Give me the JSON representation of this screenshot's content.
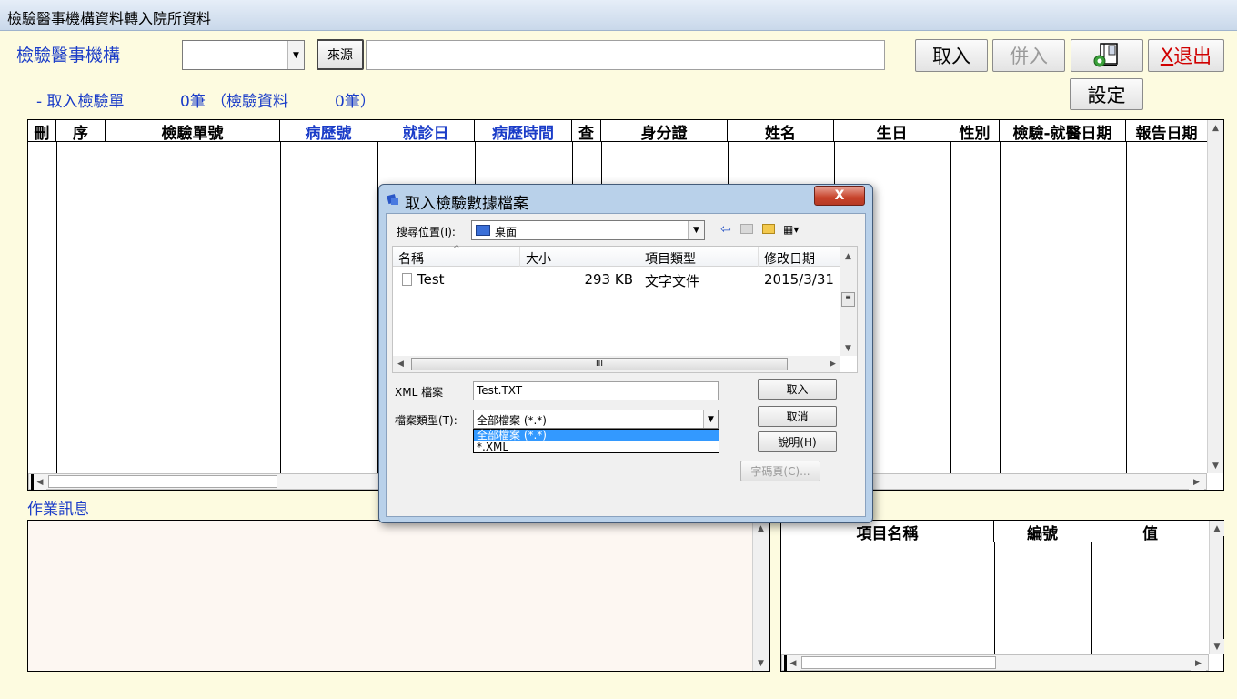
{
  "window": {
    "title": "檢驗醫事機構資料轉入院所資料"
  },
  "header": {
    "agency_label": "檢驗醫事機構",
    "agency_value": "",
    "source_button": "來源",
    "source_path": "",
    "import_button": "取入",
    "merge_button": "併入",
    "exit_button_key": "X",
    "exit_button_label": "退出",
    "settings_button": "設定",
    "summary_prefix": "-  取入檢驗單",
    "order_count": "0筆",
    "data_count_label": "（檢驗資料",
    "data_count": "0筆）"
  },
  "grid": {
    "columns": [
      "刪",
      "序",
      "檢驗單號",
      "病歷號",
      "就診日",
      "病歷時間",
      "查",
      "身分證",
      "姓名",
      "生日",
      "性別",
      "檢驗-就醫日期",
      "報告日期"
    ]
  },
  "log": {
    "label": "作業訊息"
  },
  "detail_grid": {
    "columns": [
      "項目名稱",
      "編號",
      "值"
    ]
  },
  "dialog": {
    "title": "取入檢驗數據檔案",
    "close": "X",
    "look_in_label": "搜尋位置(I):",
    "look_in_value": "桌面",
    "file_columns": [
      "名稱",
      "大小",
      "項目類型",
      "修改日期"
    ],
    "files": [
      {
        "name": "Test",
        "size": "293 KB",
        "type": "文字文件",
        "date": "2015/3/31"
      }
    ],
    "scroll_grip": "III",
    "filename_label": "XML 檔案",
    "filename_value": "Test.TXT",
    "filetype_label": "檔案類型(T):",
    "filetype_value": "全部檔案 (*.*)",
    "filetype_options": [
      "全部檔案 (*.*)",
      "*.XML"
    ],
    "open_button": "取入",
    "cancel_button": "取消",
    "help_button": "說明(H)",
    "codepage_button": "字碼頁(C)..."
  },
  "colors": {
    "label_blue": "#1a3cc8",
    "exit_red": "#d00000",
    "background": "#fdfbe0",
    "selection": "#3399ff"
  }
}
